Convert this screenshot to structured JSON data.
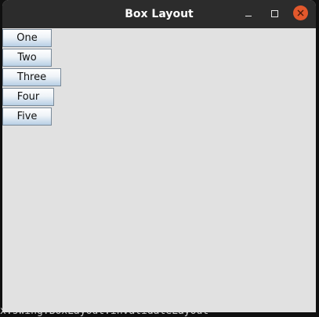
{
  "window": {
    "title": "Box Layout"
  },
  "buttons": [
    "One",
    "Two",
    "Three",
    "Four",
    "Five"
  ],
  "background_terminal": {
    "bottom_line": "x.swing.BoxLayout.invalidateLayout"
  },
  "colors": {
    "titlebar": "#2c2c2c",
    "content": "#e1e1e1",
    "close_button": "#e2582c"
  }
}
